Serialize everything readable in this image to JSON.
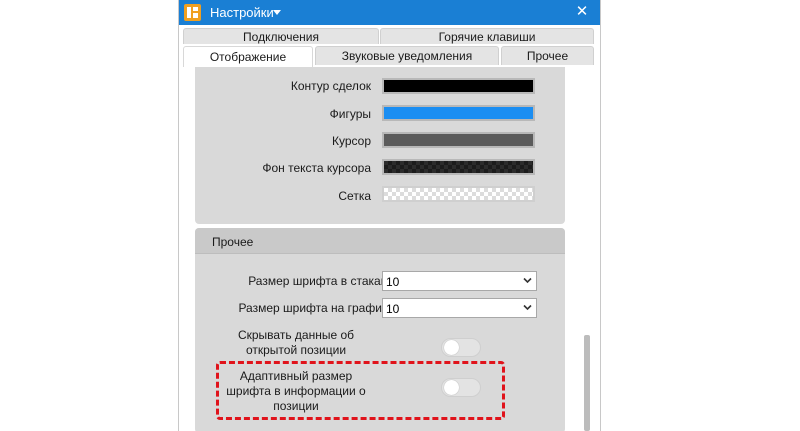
{
  "window": {
    "title": "Настройки",
    "close_glyph": "✕"
  },
  "tabs": [
    {
      "label": "Подключения",
      "active": false
    },
    {
      "label": "Горячие клавиши",
      "active": false
    },
    {
      "label": "Отображение",
      "active": true
    },
    {
      "label": "Звуковые уведомления",
      "active": false
    },
    {
      "label": "Прочее",
      "active": false
    }
  ],
  "colors_section": {
    "rows": [
      {
        "label": "Контур сделок",
        "color": "#000000"
      },
      {
        "label": "Фигуры",
        "color": "#1b8ef2"
      },
      {
        "label": "Курсор",
        "color": "#5b5b5b"
      },
      {
        "label": "Фон текста курсора",
        "color": "dark-checker"
      },
      {
        "label": "Сетка",
        "color": "light-checker"
      }
    ]
  },
  "other_section": {
    "header": "Прочее",
    "font_size_book_label": "Размер шрифта в стакане",
    "font_size_book_value": "10",
    "font_size_chart_label": "Размер шрифта на графике",
    "font_size_chart_value": "10",
    "hide_position_label_line1": "Скрывать данные об",
    "hide_position_label_line2": "открытой позиции",
    "hide_position_on": false,
    "adaptive_font_label_line1": "Адаптивный размер",
    "adaptive_font_label_line2": "шрифта в информации о",
    "adaptive_font_label_line3": "позиции",
    "adaptive_font_on": false
  },
  "colors": {
    "titlebar": "#1a7fd4",
    "highlight": "#e0131b",
    "panel": "#d9d9d9"
  }
}
